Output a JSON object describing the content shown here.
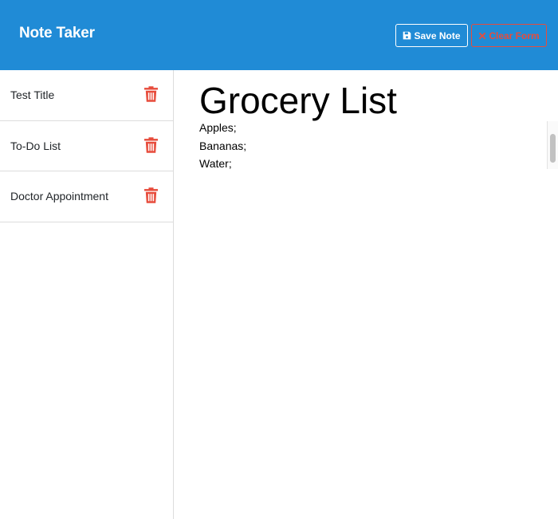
{
  "header": {
    "brand": "Note Taker",
    "save_label": "Save Note",
    "clear_label": "Clear Form",
    "colors": {
      "navbar": "#208bd6",
      "danger": "#e74c3c"
    },
    "icons": {
      "save": "floppy-disk-icon",
      "clear": "x-mark-icon"
    }
  },
  "sidebar": {
    "notes": [
      {
        "title": "Test Title"
      },
      {
        "title": "To-Do List"
      },
      {
        "title": "Doctor Appointment"
      }
    ],
    "delete_icon": "trash-icon"
  },
  "editor": {
    "title": "Grocery List",
    "body_lines": [
      "Apples;",
      "Bananas;",
      "Water;"
    ]
  }
}
